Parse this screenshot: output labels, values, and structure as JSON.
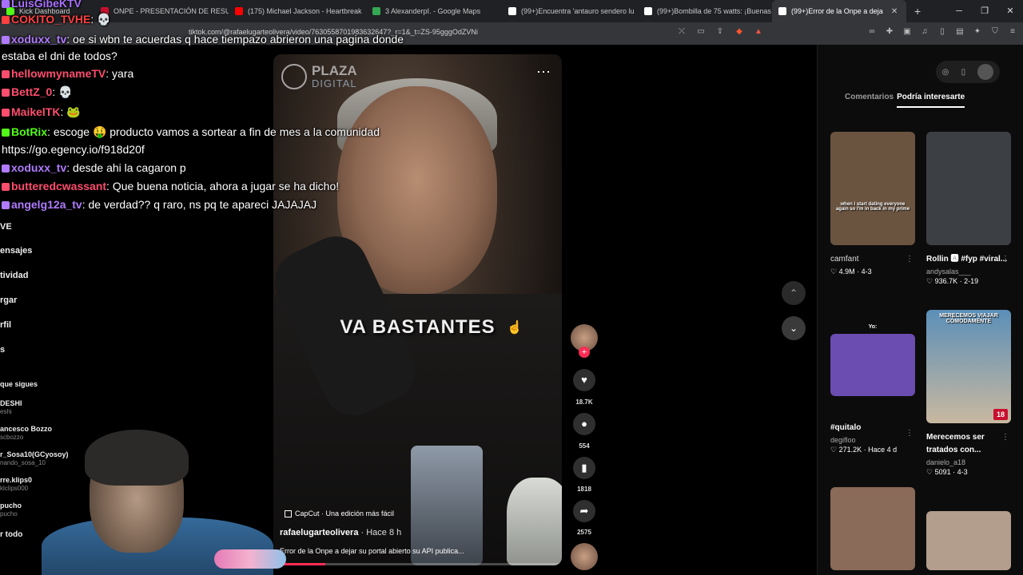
{
  "browser": {
    "tabs": [
      {
        "label": "Kick Dashboard",
        "fav_color": "#53fc18"
      },
      {
        "label": "ONPE - PRESENTACIÓN DE RESULTA",
        "fav_color": "#c8102e"
      },
      {
        "label": "(175) Michael Jackson - Heartbreak",
        "fav_color": "#ff0000"
      },
      {
        "label": "3 AlexanderpI. - Google Maps",
        "fav_color": "#34a853"
      },
      {
        "label": "(99+)Encuentra 'antauro sendero lu",
        "fav_color": "#ffffff"
      },
      {
        "label": "(99+)Bombilla de 75 watts: ¡Buenas",
        "fav_color": "#ffffff"
      },
      {
        "label": "(99+)Error de la Onpe a deja",
        "fav_color": "#ffffff"
      }
    ],
    "new_tab": "+",
    "url": "tiktok.com/@rafaelugarteolivera/video/7630558701983632647?_r=1&_t=ZS-95gggOdZVNi"
  },
  "sidebar": {
    "items": [
      "VE",
      "ensajes",
      "tividad",
      "rgar",
      "rfil",
      "s"
    ],
    "following_label": "que sigues",
    "following": [
      {
        "name": "DESHI",
        "sub": "eshi"
      },
      {
        "name": "ancesco Bozzo",
        "sub": "scbozzo"
      },
      {
        "name": "r_Sosa10(GCyosoy)",
        "sub": "nando_sosa_10"
      },
      {
        "name": "rre.klips0",
        "sub": "klclips000"
      },
      {
        "name": "pucho",
        "sub": "pucho"
      }
    ],
    "see_all": "r todo"
  },
  "chat": {
    "lines": [
      {
        "name": "LuisGibeKTV",
        "msg": "",
        "color": "#a970ff"
      },
      {
        "name": "COKITO_TVHE",
        "msg": ": 💀",
        "color": "#ff4040"
      },
      {
        "name": "xoduxx_tv",
        "msg": ": oe si wbn te acuerdas q hace tiempazo abrieron una pagina donde",
        "color": "#b07bff"
      },
      {
        "name": "",
        "msg": "estaba el dni de todos?",
        "color": "#ffffff"
      },
      {
        "name": "hellowmynameTV",
        "msg": ": yara",
        "color": "#ff4d6d"
      },
      {
        "name": "BettZ_0",
        "msg": ": 💀",
        "color": "#ff4d6d"
      },
      {
        "name": "MaikelTK",
        "msg": ": 🐸",
        "color": "#ff4d6d"
      },
      {
        "name": "BotRix",
        "msg": ": escoge 🤑 producto vamos a sortear a fin de mes a la comunidad",
        "color": "#53fc18"
      },
      {
        "name": "",
        "msg": "https://go.egency.io/f918d20f",
        "color": "#ffffff"
      },
      {
        "name": "xoduxx_tv",
        "msg": ": desde ahi la cagaron p",
        "color": "#b07bff"
      },
      {
        "name": "butteredcwassant",
        "msg": ": Que buena noticia, ahora a jugar se ha dicho!",
        "color": "#ff4d6d"
      },
      {
        "name": "angelg12a_tv",
        "msg": ": de verdad?? q raro, ns pq te apareci JAJAJAJ",
        "color": "#b07bff"
      }
    ]
  },
  "video": {
    "brand_line1": "PLAZA",
    "brand_line2": "DIGITAL",
    "caption_overlay": "VA BASTANTES",
    "capcut_label": "CapCut · Una edición más fácil",
    "author": "rafaelugarteolivera",
    "time": " · Hace 8 h",
    "description": "Error de la Onpe a dejar su portal abierto su API publica...",
    "progress": 0.18
  },
  "actions": {
    "likes": "18.7K",
    "comments": "554",
    "saves": "1818",
    "shares": "2575"
  },
  "panel": {
    "tab_comments": "Comentarios",
    "tab_related": "Podría interesarte",
    "cards": [
      {
        "title": "camfant",
        "title_style": "thin",
        "user": "",
        "stats": "♡ 4.9M · 4-3",
        "thumb_caption": "when i start dating everyone again so I'm in back in my prime",
        "thumb_color": "#6a5440"
      },
      {
        "title": "Rollin 🅰 #fyp #viral...",
        "title_style": "bold",
        "user": "andysalas___",
        "stats": "♡ 936.7K · 2-19",
        "thumb_caption": "",
        "thumb_color": "#3c3f44"
      },
      {
        "title": "#quitalo",
        "title_style": "bold",
        "user": "degifloo",
        "stats": "♡ 271.2K · Hace 4 d",
        "thumb_caption": "Yo:",
        "thumb_color": "#6b4cb0"
      },
      {
        "title": "Merecemos ser tratados con...",
        "title_style": "bold",
        "user": "danielo_a18",
        "stats": "♡ 5091 · 4-3",
        "thumb_caption": "MERECEMOS VIAJAR CÓMODAMENTE",
        "thumb_color": "#5b8fb8",
        "badge": "18"
      },
      {
        "title": "",
        "title_style": "thin",
        "user": "",
        "stats": "",
        "thumb_caption": "",
        "thumb_color": "#8a6a58"
      },
      {
        "title": "",
        "title_style": "thin",
        "user": "",
        "stats": "",
        "thumb_caption": "",
        "thumb_color": "#b39d8c"
      }
    ]
  },
  "colors": {
    "tiktok_red": "#fe2c55",
    "chrome_dark": "#202124",
    "chrome_mid": "#35363a"
  }
}
